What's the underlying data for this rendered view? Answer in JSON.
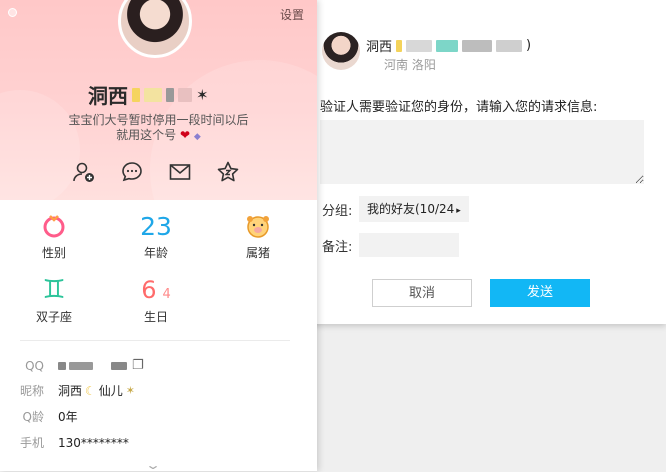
{
  "profile": {
    "settings_label": "设置",
    "nickname": "洞西",
    "bio_line1": "宝宝们大号暂时停用一段时间以后",
    "bio_line2": "就用这个号",
    "actions": [
      {
        "icon": "add-friend-icon"
      },
      {
        "icon": "chat-icon"
      },
      {
        "icon": "mail-icon"
      },
      {
        "icon": "favorite-star-icon"
      }
    ],
    "info": {
      "gender_label": "性别",
      "age_value": "23",
      "age_label": "年龄",
      "zodiac_label": "属猪",
      "constellation_label": "双子座",
      "birthday_month": "6",
      "birthday_day": "4",
      "birthday_label": "生日"
    },
    "details": {
      "qq_key": "QQ",
      "nickname_key": "昵称",
      "nickname_value": "洞西",
      "nickname_suffix": "仙儿",
      "qage_key": "Q龄",
      "qage_value": "0年",
      "phone_key": "手机",
      "phone_value": "130********"
    }
  },
  "dialog": {
    "location": "河南 洛阳",
    "prompt": "验证人需要验证您的身份，请输入您的请求信息:",
    "group_label": "分组:",
    "group_value": "我的好友(10/24",
    "remark_label": "备注:",
    "cancel_label": "取消",
    "send_label": "发送",
    "accent_color": "#12b7f5"
  }
}
